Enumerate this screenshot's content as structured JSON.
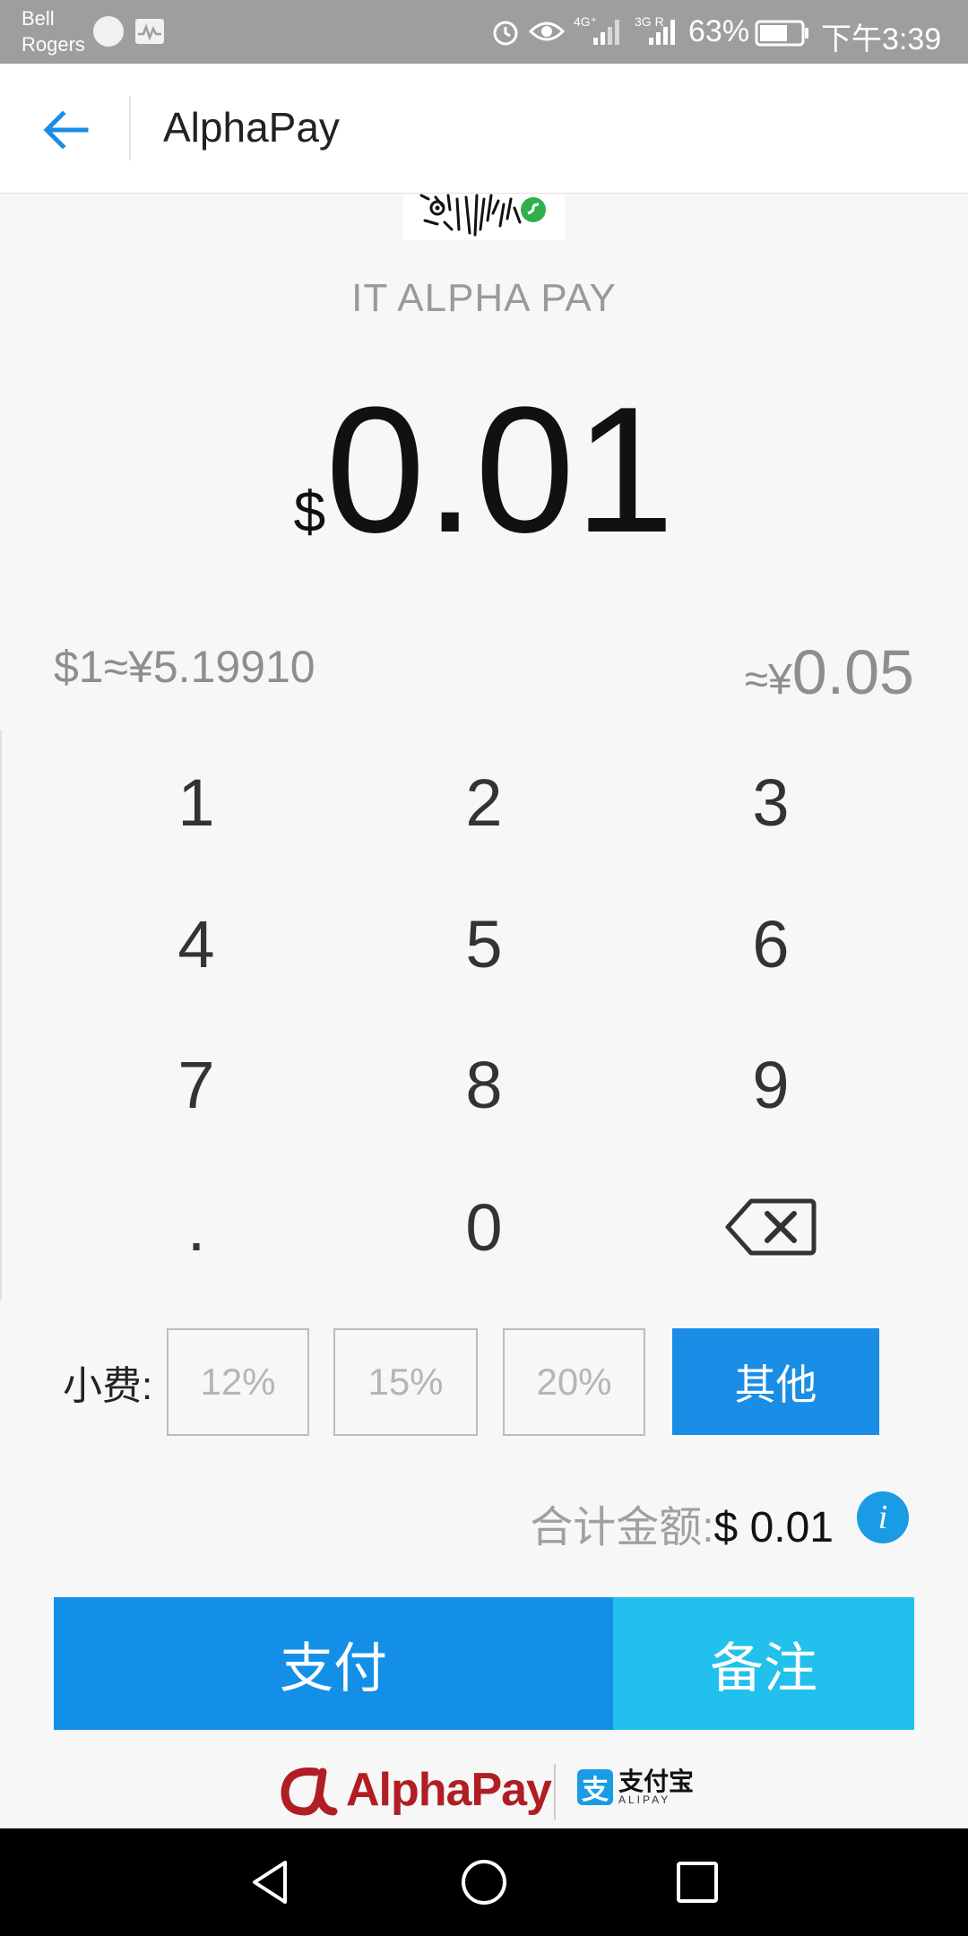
{
  "status_bar": {
    "carrier_line1": "Bell",
    "carrier_line2": "Rogers",
    "network1": "4G⁺",
    "network2": "3G R",
    "battery": "63%",
    "time": "下午3:39",
    "icons": [
      "app-icon",
      "activity-icon",
      "alarm-icon",
      "eye-icon",
      "signal-icon",
      "battery-icon"
    ]
  },
  "header": {
    "title": "AlphaPay",
    "back_icon": "arrow-left-icon"
  },
  "merchant": {
    "name": "IT ALPHA PAY"
  },
  "amount": {
    "currency": "$",
    "value": "0.01"
  },
  "exchange": {
    "rate": "$1≈¥5.19910",
    "approx_prefix": "≈¥",
    "approx_value": "0.05"
  },
  "keypad": {
    "keys": [
      "1",
      "2",
      "3",
      "4",
      "5",
      "6",
      "7",
      "8",
      "9",
      ".",
      "0"
    ],
    "backspace_icon": "backspace-icon"
  },
  "tips": {
    "label": "小费:",
    "options": [
      "12%",
      "15%",
      "20%"
    ],
    "other": "其他"
  },
  "total": {
    "label": "合计金额:",
    "value": "$ 0.01",
    "info": "i"
  },
  "actions": {
    "pay": "支付",
    "note": "备注"
  },
  "footer": {
    "brand": "AlphaPay",
    "alipay_cn": "支付宝",
    "alipay_en": "ALIPAY",
    "alipay_mark": "支"
  },
  "colors": {
    "primary": "#148fe8",
    "secondary": "#22c0ec",
    "brand_red": "#b01e24",
    "status_bar": "#9e9e9e"
  }
}
